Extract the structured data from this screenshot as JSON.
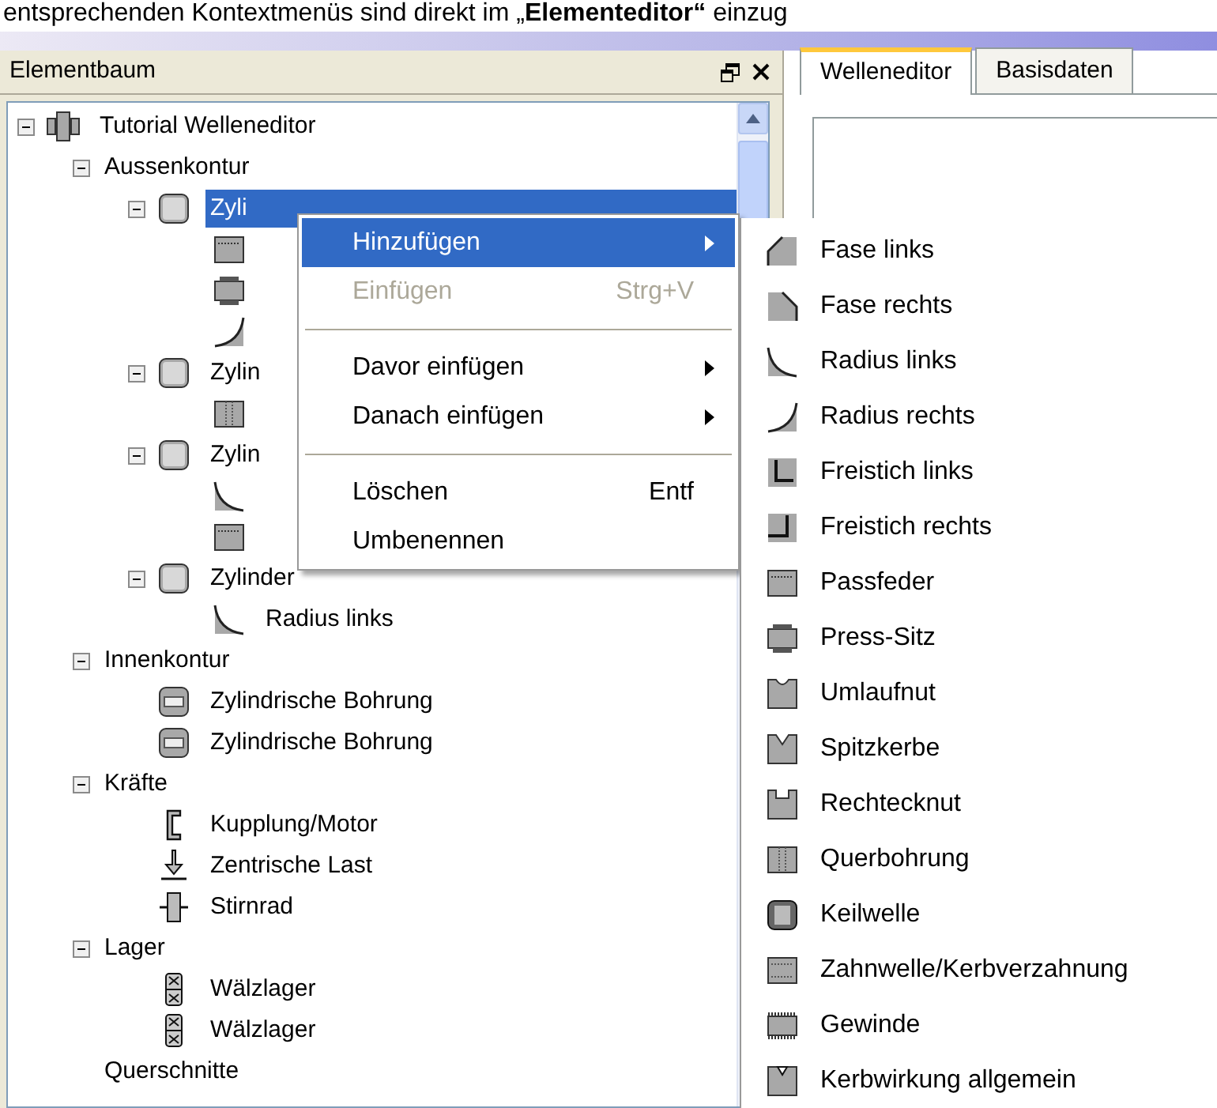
{
  "caption": "entsprechenden Kontextmenüs sind direkt im „**Elementeditor“** einzug",
  "panel": {
    "title": "Elementbaum"
  },
  "tabs": [
    {
      "label": "Welleneditor",
      "selected": true
    },
    {
      "label": "Basisdaten",
      "selected": false
    }
  ],
  "tree": [
    {
      "label": "Tutorial Welleneditor",
      "kind": "shaft",
      "expanded": true,
      "selected": false,
      "children": [
        {
          "label": "Aussenkontur",
          "expanded": true,
          "selected": false,
          "children": [
            {
              "label": "Zyli",
              "kind": "cylinder",
              "expanded": true,
              "selected": true,
              "children": [
                {
                  "kind": "keyway",
                  "selected": false
                },
                {
                  "kind": "press-fit",
                  "selected": false
                },
                {
                  "kind": "radius-right",
                  "selected": false
                }
              ]
            },
            {
              "label": "Zylin",
              "kind": "cylinder",
              "expanded": true,
              "selected": false,
              "children": [
                {
                  "kind": "cross-hole",
                  "selected": false
                }
              ]
            },
            {
              "label": "Zylin",
              "kind": "cylinder",
              "expanded": true,
              "selected": false,
              "children": [
                {
                  "kind": "radius-left",
                  "selected": false
                },
                {
                  "kind": "keyway",
                  "selected": false
                }
              ]
            },
            {
              "label": "Zylinder",
              "kind": "cylinder",
              "expanded": true,
              "selected": false,
              "children": [
                {
                  "label": "Radius links",
                  "kind": "radius-left",
                  "selected": false
                }
              ]
            }
          ]
        },
        {
          "label": "Innenkontur",
          "expanded": true,
          "selected": false,
          "children": [
            {
              "label": "Zylindrische Bohrung",
              "kind": "bore",
              "selected": false
            },
            {
              "label": "Zylindrische Bohrung",
              "kind": "bore",
              "selected": false
            }
          ]
        },
        {
          "label": "Kräfte",
          "expanded": true,
          "selected": false,
          "children": [
            {
              "label": "Kupplung/Motor",
              "kind": "coupling",
              "selected": false
            },
            {
              "label": "Zentrische Last",
              "kind": "load",
              "selected": false
            },
            {
              "label": "Stirnrad",
              "kind": "gear",
              "selected": false
            }
          ]
        },
        {
          "label": "Lager",
          "expanded": true,
          "selected": false,
          "children": [
            {
              "label": "Wälzlager",
              "kind": "bearing",
              "selected": false
            },
            {
              "label": "Wälzlager",
              "kind": "bearing",
              "selected": false
            }
          ]
        },
        {
          "label": "Querschnitte",
          "selected": false
        }
      ]
    }
  ],
  "context_menu": [
    {
      "label": "Hinzufügen",
      "submenu": true,
      "disabled": false,
      "selected": true
    },
    {
      "label": "Einfügen",
      "shortcut": "Strg+V",
      "submenu": false,
      "disabled": true,
      "selected": false
    },
    {
      "kind": "separator"
    },
    {
      "label": "Davor einfügen",
      "submenu": true,
      "disabled": false,
      "selected": false
    },
    {
      "label": "Danach einfügen",
      "submenu": true,
      "disabled": false,
      "selected": false
    },
    {
      "kind": "separator"
    },
    {
      "label": "Löschen",
      "shortcut": "Entf",
      "submenu": false,
      "disabled": false,
      "selected": false
    },
    {
      "label": "Umbenennen",
      "submenu": false,
      "disabled": false,
      "selected": false
    }
  ],
  "submenu": [
    {
      "label": "Fase links",
      "kind": "chamfer-left"
    },
    {
      "label": "Fase rechts",
      "kind": "chamfer-right"
    },
    {
      "label": "Radius links",
      "kind": "radius-left"
    },
    {
      "label": "Radius rechts",
      "kind": "radius-right"
    },
    {
      "label": "Freistich links",
      "kind": "undercut-left"
    },
    {
      "label": "Freistich rechts",
      "kind": "undercut-right"
    },
    {
      "label": "Passfeder",
      "kind": "keyway"
    },
    {
      "label": "Press-Sitz",
      "kind": "press-fit"
    },
    {
      "label": "Umlaufnut",
      "kind": "groove"
    },
    {
      "label": "Spitzkerbe",
      "kind": "notch"
    },
    {
      "label": "Rechtecknut",
      "kind": "rect-groove"
    },
    {
      "label": "Querbohrung",
      "kind": "cross-hole"
    },
    {
      "label": "Keilwelle",
      "kind": "spline"
    },
    {
      "label": "Zahnwelle/Kerbverzahnung",
      "kind": "serration"
    },
    {
      "label": "Gewinde",
      "kind": "thread"
    },
    {
      "label": "Kerbwirkung allgemein",
      "kind": "notch-general"
    }
  ]
}
